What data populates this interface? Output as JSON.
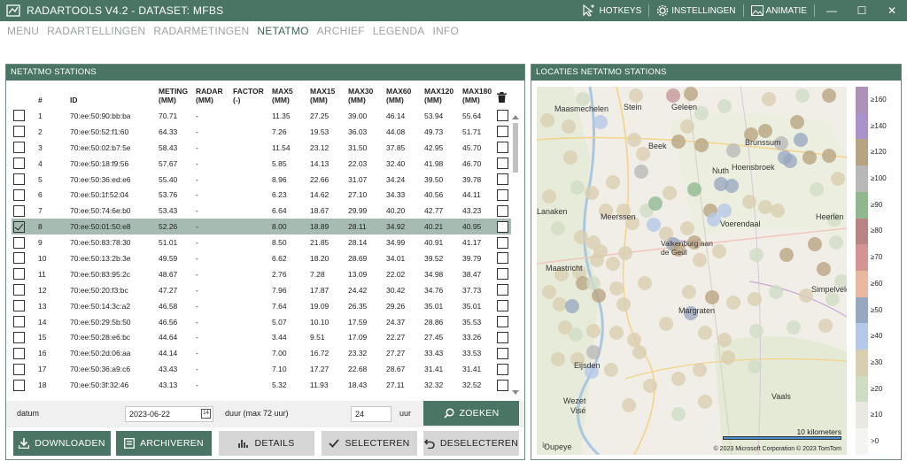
{
  "app": {
    "title": "RADARTOOLS V4.2 - DATASET: MFBS",
    "hotkeys": "HOTKEYS",
    "settings": "INSTELLINGEN",
    "animation": "ANIMATIE"
  },
  "menu": [
    "MENU",
    "RADARTELLINGEN",
    "RADARMETINGEN",
    "NETATMO",
    "ARCHIEF",
    "LEGENDA",
    "INFO"
  ],
  "left_panel": {
    "title": "NETATMO STATIONS",
    "columns": {
      "nr": "#",
      "id": "ID",
      "meting": [
        "METING",
        "(MM)"
      ],
      "radar": [
        "RADAR",
        "(MM)"
      ],
      "factor": [
        "FACTOR",
        "(-)"
      ],
      "max5": [
        "MAX5",
        "(MM)"
      ],
      "max15": [
        "MAX15",
        "(MM)"
      ],
      "max30": [
        "MAX30",
        "(MM)"
      ],
      "max60": [
        "MAX60",
        "(MM)"
      ],
      "max120": [
        "MAX120",
        "(MM)"
      ],
      "max180": [
        "MAX180",
        "(MM)"
      ]
    },
    "rows": [
      {
        "nr": "1",
        "id": "70:ee:50:90:bb:ba",
        "meting": "70.71",
        "radar": "-",
        "factor": "",
        "max5": "11.35",
        "max15": "27.25",
        "max30": "39.00",
        "max60": "46.14",
        "max120": "53.94",
        "max180": "55.64",
        "checked": false
      },
      {
        "nr": "2",
        "id": "70:ee:50:52:f1:60",
        "meting": "64.33",
        "radar": "-",
        "factor": "",
        "max5": "7.26",
        "max15": "19.53",
        "max30": "36.03",
        "max60": "44.08",
        "max120": "49.73",
        "max180": "51.71",
        "checked": false
      },
      {
        "nr": "3",
        "id": "70:ee:50:02:b7:5e",
        "meting": "58.43",
        "radar": "-",
        "factor": "",
        "max5": "11.54",
        "max15": "23.12",
        "max30": "31.50",
        "max60": "37.85",
        "max120": "42.95",
        "max180": "45.70",
        "checked": false
      },
      {
        "nr": "4",
        "id": "70:ee:50:18:f9:56",
        "meting": "57.67",
        "radar": "-",
        "factor": "",
        "max5": "5.85",
        "max15": "14.13",
        "max30": "22.03",
        "max60": "32.40",
        "max120": "41.98",
        "max180": "46.70",
        "checked": false
      },
      {
        "nr": "5",
        "id": "70:ee:50:36:ed:e6",
        "meting": "55.40",
        "radar": "-",
        "factor": "",
        "max5": "8.96",
        "max15": "22.66",
        "max30": "31.07",
        "max60": "34.24",
        "max120": "39.50",
        "max180": "39.78",
        "checked": false
      },
      {
        "nr": "6",
        "id": "70:ee:50:1f:52:04",
        "meting": "53.76",
        "radar": "-",
        "factor": "",
        "max5": "6.23",
        "max15": "14.62",
        "max30": "27.10",
        "max60": "34.33",
        "max120": "40.56",
        "max180": "44.11",
        "checked": false
      },
      {
        "nr": "7",
        "id": "70:ee:50:74:6e:b0",
        "meting": "53.43",
        "radar": "-",
        "factor": "",
        "max5": "6.64",
        "max15": "18.67",
        "max30": "29.99",
        "max60": "40.20",
        "max120": "42.77",
        "max180": "43.23",
        "checked": false
      },
      {
        "nr": "8",
        "id": "70:ee:50:01:50:e8",
        "meting": "52.26",
        "radar": "-",
        "factor": "",
        "max5": "8.00",
        "max15": "18.89",
        "max30": "28.11",
        "max60": "34.92",
        "max120": "40.21",
        "max180": "40.95",
        "checked": true
      },
      {
        "nr": "9",
        "id": "70:ee:50:83:78:30",
        "meting": "51.01",
        "radar": "-",
        "factor": "",
        "max5": "8.50",
        "max15": "21.85",
        "max30": "28.14",
        "max60": "34.99",
        "max120": "40.91",
        "max180": "41.17",
        "checked": false
      },
      {
        "nr": "10",
        "id": "70:ee:50:13:2b:3e",
        "meting": "49.59",
        "radar": "-",
        "factor": "",
        "max5": "6.62",
        "max15": "18.20",
        "max30": "28.69",
        "max60": "34.01",
        "max120": "39.52",
        "max180": "39.79",
        "checked": false
      },
      {
        "nr": "11",
        "id": "70:ee:50:83:95:2c",
        "meting": "48.67",
        "radar": "-",
        "factor": "",
        "max5": "2.76",
        "max15": "7.28",
        "max30": "13.09",
        "max60": "22.02",
        "max120": "34.98",
        "max180": "38.47",
        "checked": false
      },
      {
        "nr": "12",
        "id": "70:ee:50:20:f3:bc",
        "meting": "47.27",
        "radar": "-",
        "factor": "",
        "max5": "7.96",
        "max15": "17.87",
        "max30": "24.42",
        "max60": "30.42",
        "max120": "34.76",
        "max180": "37.73",
        "checked": false
      },
      {
        "nr": "13",
        "id": "70:ee:50:14:3c:a2",
        "meting": "46.58",
        "radar": "-",
        "factor": "",
        "max5": "7.64",
        "max15": "19.09",
        "max30": "26.35",
        "max60": "29.26",
        "max120": "35.01",
        "max180": "35.01",
        "checked": false
      },
      {
        "nr": "14",
        "id": "70:ee:50:29:5b:50",
        "meting": "46.56",
        "radar": "-",
        "factor": "",
        "max5": "5.07",
        "max15": "10.10",
        "max30": "17.59",
        "max60": "24.37",
        "max120": "28.86",
        "max180": "35.53",
        "checked": false
      },
      {
        "nr": "15",
        "id": "70:ee:50:28:e6:bc",
        "meting": "44.64",
        "radar": "-",
        "factor": "",
        "max5": "3.44",
        "max15": "9.51",
        "max30": "17.09",
        "max60": "22.27",
        "max120": "27.45",
        "max180": "33.26",
        "checked": false
      },
      {
        "nr": "16",
        "id": "70:ee:50:2d:06:aa",
        "meting": "44.14",
        "radar": "-",
        "factor": "",
        "max5": "7.00",
        "max15": "16.72",
        "max30": "23.32",
        "max60": "27.27",
        "max120": "33.43",
        "max180": "33.53",
        "checked": false
      },
      {
        "nr": "17",
        "id": "70:ee:50:36:a9:c6",
        "meting": "43.43",
        "radar": "-",
        "factor": "",
        "max5": "7.10",
        "max15": "17.27",
        "max30": "22.68",
        "max60": "28.67",
        "max120": "31.41",
        "max180": "31.41",
        "checked": false
      },
      {
        "nr": "18",
        "id": "70:ee:50:3f:32:46",
        "meting": "43.13",
        "radar": "-",
        "factor": "",
        "max5": "5.32",
        "max15": "11.93",
        "max30": "18.43",
        "max60": "27.11",
        "max120": "32.32",
        "max180": "32.52",
        "checked": false
      }
    ],
    "date_label": "datum",
    "date_value": "2023-06-22",
    "duration_label": "duur (max 72 uur)",
    "duration_value": "24",
    "duration_unit": "uur",
    "search_button": "ZOEKEN",
    "buttons": {
      "download": "DOWNLOADEN",
      "archive": "ARCHIVEREN",
      "details": "DETAILS",
      "select": "SELECTEREN",
      "deselect": "DESELECTEREN"
    }
  },
  "right_panel": {
    "title": "LOCATIES NETATMO STATIONS",
    "places": [
      "Maasmechelen",
      "Stein",
      "Geleen",
      "Beek",
      "Brunssum",
      "Nuth",
      "Hoensbroek",
      "Lanaken",
      "Meerssen",
      "Voerendaal",
      "Heerlen",
      "Valkenburg aan de Geul",
      "Maastricht",
      "Simpelveld",
      "Margraten",
      "Eijsden",
      "Vaals",
      "Wezet",
      "Visé",
      "Oupeye"
    ],
    "scale_label": "10 kilometers",
    "copyright": "© 2023 Microsoft Corporation   © 2023 TomTom",
    "legend": [
      "≥160",
      "≥140",
      "≥120",
      "≥100",
      "≥90",
      "≥80",
      "≥70",
      "≥60",
      "≥50",
      "≥40",
      "≥30",
      "≥20",
      "≥10",
      ">0"
    ],
    "legend_colors": [
      "#b08fb8",
      "#a892c8",
      "#b8a482",
      "#b8b8b8",
      "#8fb88f",
      "#b88484",
      "#d49494",
      "#e8b8a0",
      "#98a8c0",
      "#b4c8e8",
      "#d8ceb0",
      "#cfdcc4",
      "#e9e9e2",
      "#f4f4f0"
    ]
  }
}
